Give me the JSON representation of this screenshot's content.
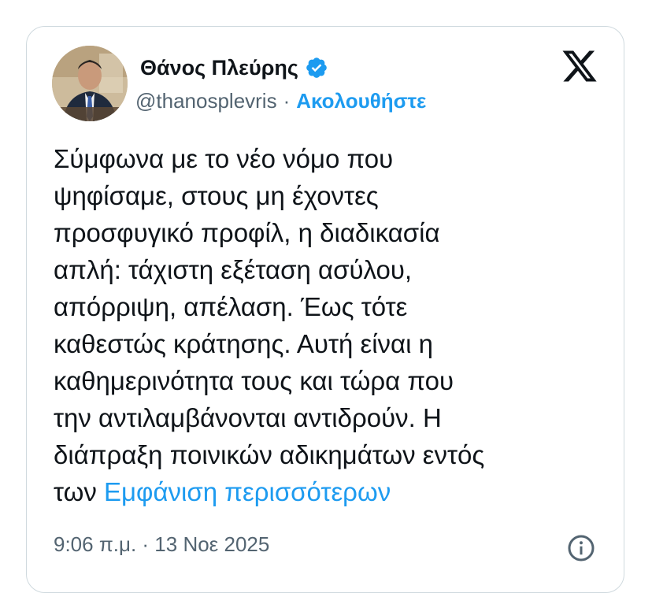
{
  "tweet": {
    "author": {
      "display_name": "Θάνος Πλεύρης",
      "handle": "@thanosplevris",
      "separator": "·",
      "follow_label": "Ακολουθήστε",
      "verified": true,
      "avatar_icon": "profile-photo"
    },
    "platform_icon": "x-logo-icon",
    "text_lines": [
      "Σύμφωνα με το νέο νόμο που",
      "ψηφίσαμε, στους μη έχοντες",
      "προσφυγικό προφίλ, η διαδικασία",
      "απλή: τάχιστη εξέταση ασύλου,",
      "απόρριψη, απέλαση. Έως τότε",
      "καθεστώς κράτησης. Αυτή είναι η",
      "καθημερινότητα τους και τώρα που",
      "την αντιλαμβάνονται αντιδρούν. Η",
      "διάπραξη ποινικών αδικημάτων εντός",
      "των"
    ],
    "show_more_label": "Εμφάνιση περισσότερων",
    "timestamp": "9:06 π.μ. · 13 Νοε 2025",
    "info_icon": "info-icon"
  },
  "colors": {
    "accent": "#1d9bf0",
    "text_primary": "#0f1419",
    "text_secondary": "#536471",
    "border": "#cfd9de"
  }
}
